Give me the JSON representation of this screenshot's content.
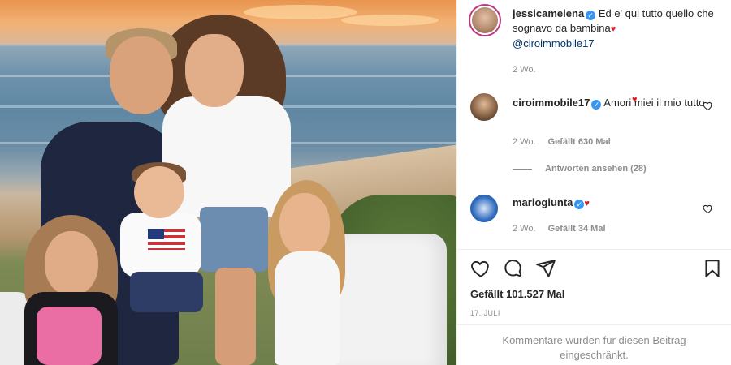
{
  "post": {
    "username": "jessicamelena",
    "caption": "Ed e' qui tutto quello che sognavo da bambina",
    "mention": "@ciroimmobile17",
    "age": "2 Wo.",
    "likes": "Gefällt 101.527 Mal",
    "date": "17. JULI",
    "restricted_line1": "Kommentare wurden für diesen Beitrag",
    "restricted_line2": "eingeschränkt."
  },
  "comments": [
    {
      "username": "ciroimmobile17",
      "text": "Amori miei il mio tutto",
      "age": "2 Wo.",
      "likes": "Gefällt 630 Mal",
      "replies": "Antworten ansehen (28)"
    },
    {
      "username": "mariogiunta",
      "text": "",
      "age": "2 Wo.",
      "likes": "Gefällt 34 Mal"
    }
  ],
  "icons": {
    "verified": "✓",
    "heart_emoji": "♥",
    "like": "heart-icon",
    "comment": "comment-icon",
    "share": "share-icon",
    "save": "bookmark-icon"
  },
  "colors": {
    "verified_blue": "#3897f0",
    "mention_blue": "#00376b",
    "meta_gray": "#8e8e8e",
    "avatar_ring": "#c13584"
  }
}
